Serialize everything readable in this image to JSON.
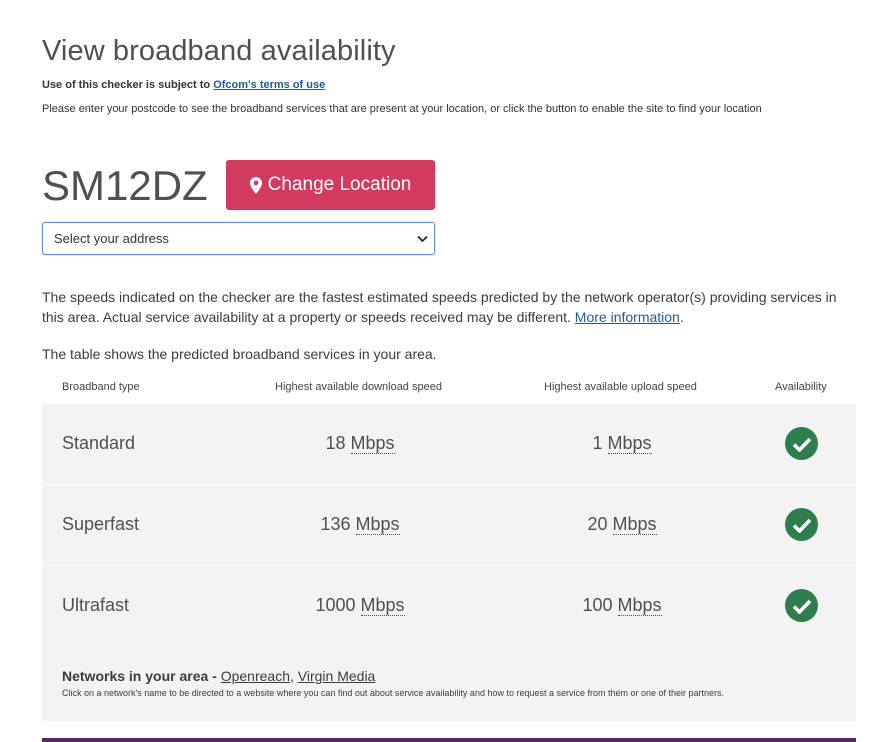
{
  "header": {
    "title": "View broadband availability",
    "terms_prefix": "Use of this checker is subject to",
    "terms_link": "Ofcom's terms of use",
    "instructions": "Please enter your postcode to see the broadband services that are present at your location, or click the button to enable the site to find your location"
  },
  "location": {
    "postcode": "SM12DZ",
    "change_button_label": "Change Location",
    "change_button_color": "#d23b5f",
    "address_select_value": "Select your address"
  },
  "info": {
    "disclaimer": "The speeds indicated on the checker are the fastest estimated speeds predicted by the network operator(s) providing services in this area. Actual service availability at a property or speeds received may be different.",
    "more_info_link": "More information",
    "table_intro": "The table shows the predicted broadband services in your area."
  },
  "table": {
    "headers": {
      "type": "Broadband type",
      "download": "Highest available download speed",
      "upload": "Highest available upload speed",
      "availability": "Availability"
    },
    "unit": "Mbps",
    "rows": [
      {
        "type": "Standard",
        "download": "18",
        "upload": "1",
        "available": true
      },
      {
        "type": "Superfast",
        "download": "136",
        "upload": "20",
        "available": true
      },
      {
        "type": "Ultrafast",
        "download": "1000",
        "upload": "100",
        "available": true
      }
    ],
    "check_color": "#2e7d4f"
  },
  "networks": {
    "label": "Networks in your area -",
    "links": [
      "Openreach",
      "Virgin Media"
    ],
    "note": "Click on a network's name to be directed to a website where you can find out about service availability and how to request a service from them or one of their partners."
  }
}
